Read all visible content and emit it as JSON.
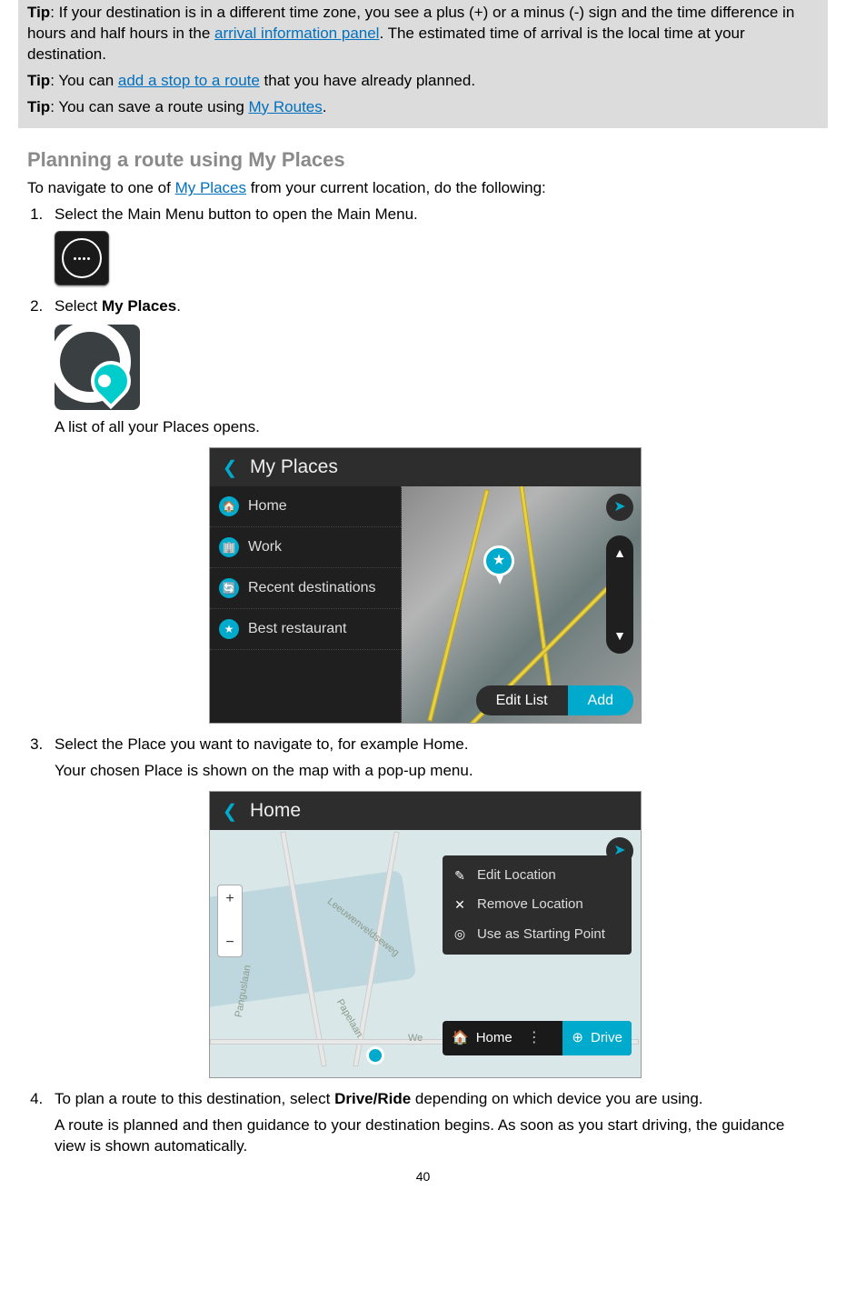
{
  "tips": {
    "label": "Tip",
    "tip1": {
      "before_link": ": If your destination is in a different time zone, you see a plus (+) or a minus (-) sign and the time difference in hours and half hours in the ",
      "link": "arrival information panel",
      "after_link": ". The estimated time of arrival is the local time at your destination."
    },
    "tip2": {
      "before_link": ": You can ",
      "link": "add a stop to a route",
      "after_link": " that you have already planned."
    },
    "tip3": {
      "before_link": ": You can save a route using ",
      "link": "My Routes",
      "after_link": "."
    }
  },
  "section_title": "Planning a route using My Places",
  "intro": {
    "before_link": "To navigate to one of ",
    "link": "My Places",
    "after_link": " from your current location, do the following:"
  },
  "steps": {
    "s1": "Select the Main Menu button to open the Main Menu.",
    "s2_before": "Select ",
    "s2_bold": "My Places",
    "s2_after": ".",
    "s2_sub": "A list of all your Places opens.",
    "s3_a": "Select the Place you want to navigate to, for example Home.",
    "s3_b": "Your chosen Place is shown on the map with a pop-up menu.",
    "s4_a_before": "To plan a route to this destination, select ",
    "s4_a_bold": "Drive/Ride",
    "s4_a_after": " depending on which device you are using.",
    "s4_b": "A route is planned and then guidance to your destination begins. As soon as you start driving, the guidance view is shown automatically."
  },
  "screenshot1": {
    "header": "My Places",
    "items": [
      "Home",
      "Work",
      "Recent destinations",
      "Best restaurant"
    ],
    "edit_btn": "Edit List",
    "add_btn": "Add"
  },
  "screenshot2": {
    "header": "Home",
    "popup": {
      "edit": "Edit Location",
      "remove": "Remove Location",
      "use_start": "Use as Starting Point"
    },
    "bar": {
      "home": "Home",
      "drive": "Drive"
    },
    "roads": {
      "panguslaan": "Panguslaan",
      "leeuwen": "Leeuwenveldseweg",
      "papelaan": "Papelaan",
      "we": "We"
    },
    "zoom": {
      "plus": "+",
      "minus": "−"
    }
  },
  "page_number": "40"
}
